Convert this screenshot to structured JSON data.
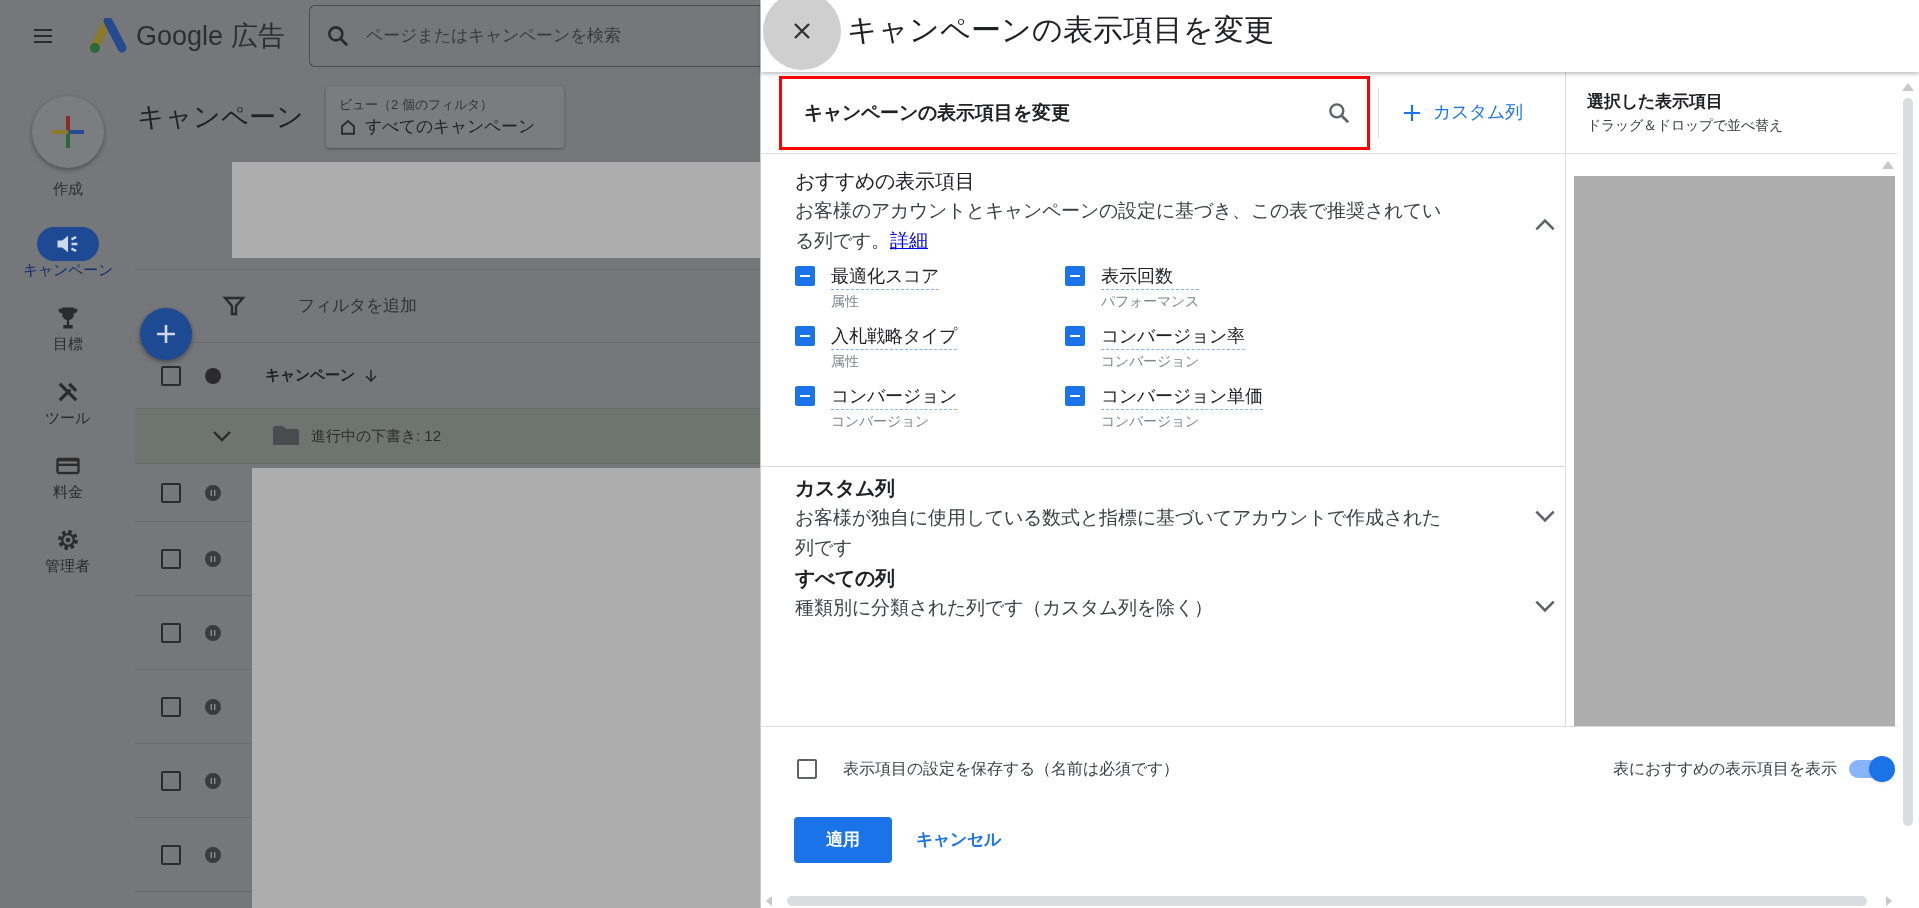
{
  "app_header": {
    "product_name": "Google 広告",
    "search_placeholder": "ページまたはキャンペーンを検索"
  },
  "sidebar": {
    "create_label": "作成",
    "items": [
      {
        "kind": "megaphone",
        "label": "キャンペーン",
        "selected": true
      },
      {
        "kind": "trophy",
        "label": "目標",
        "selected": false
      },
      {
        "kind": "tools",
        "label": "ツール",
        "selected": false
      },
      {
        "kind": "card",
        "label": "料金",
        "selected": false
      },
      {
        "kind": "gear",
        "label": "管理者",
        "selected": false
      }
    ]
  },
  "page": {
    "title": "キャンペーン",
    "view_label": "ビュー（2 個のフィルタ）",
    "view_name": "すべてのキャンペーン",
    "filter_label": "フィルタを追加",
    "column_header": "キャンペーン",
    "draft_group": "進行中の下書き: 12",
    "header_checked": false,
    "rows": [
      {
        "checked": false,
        "kind": "paused"
      },
      {
        "checked": false,
        "kind": "paused"
      },
      {
        "checked": false,
        "kind": "paused"
      },
      {
        "checked": false,
        "kind": "paused"
      },
      {
        "checked": false,
        "kind": "paused"
      },
      {
        "checked": false,
        "kind": "paused"
      }
    ]
  },
  "panel": {
    "title": "キャンペーンの表示項目を変更",
    "search_value": "キャンペーンの表示項目を変更",
    "custom_column_button": "カスタム列",
    "sections": [
      {
        "title": "おすすめの表示項目",
        "description": "お客様のアカウントとキャンペーンの設定に基づき、この表で推奨されている列です。",
        "link": "詳細",
        "expanded": true,
        "columns": [
          {
            "name": "最適化スコア",
            "category": "属性",
            "checked": true
          },
          {
            "name": "表示回数",
            "category": "パフォーマンス",
            "checked": true
          },
          {
            "name": "入札戦略タイプ",
            "category": "属性",
            "checked": true
          },
          {
            "name": "コンバージョン率",
            "category": "コンバージョン",
            "checked": true
          },
          {
            "name": "コンバージョン",
            "category": "コンバージョン",
            "checked": true
          },
          {
            "name": "コンバージョン単価",
            "category": "コンバージョン",
            "checked": true
          }
        ]
      },
      {
        "title": "カスタム列",
        "description": "お客様が独自に使用している数式と指標に基づいてアカウントで作成された列です",
        "expanded": false
      },
      {
        "title": "すべての列",
        "description": "種類別に分類された列です（カスタム列を除く）",
        "expanded": false
      }
    ],
    "selected_title": "選択した表示項目",
    "selected_hint": "ドラッグ＆ドロップで並べ替え",
    "save_label": "表示項目の設定を保存する（名前は必須です）",
    "save_checked": false,
    "recommend_toggle_label": "表におすすめの表示項目を表示",
    "recommend_toggle_on": true,
    "apply_button": "適用",
    "cancel_button": "キャンセル"
  }
}
